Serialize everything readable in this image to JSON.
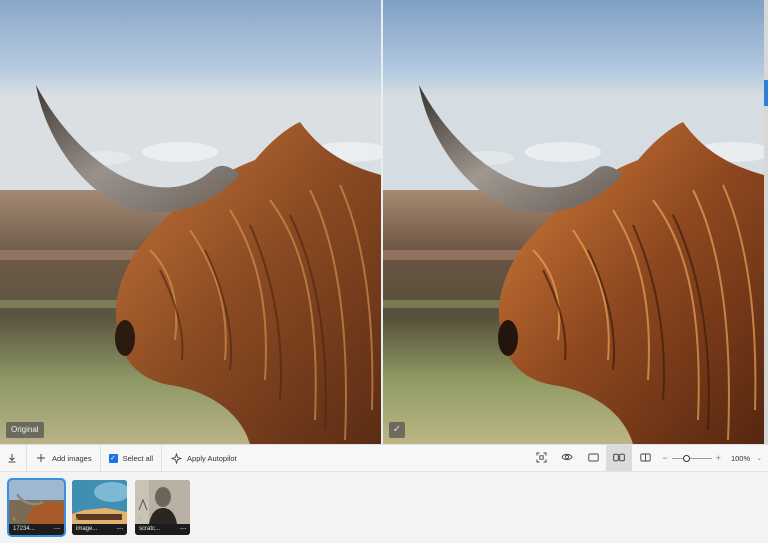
{
  "preview": {
    "original_label": "Original",
    "processed_badge": "✓"
  },
  "toolbar": {
    "export_icon": "download-icon",
    "add_images_icon": "plus-icon",
    "add_images_label": "Add images",
    "select_all_label": "Select all",
    "select_all_checked": true,
    "apply_autopilot_icon": "sparkle-icon",
    "apply_autopilot_label": "Apply Autopilot",
    "view_buttons": [
      "crop-focus-icon",
      "eye-icon",
      "single-view-icon",
      "side-by-side-icon",
      "split-view-icon"
    ],
    "active_view": "side-by-side-icon",
    "zoom_minus": "−",
    "zoom_plus": "+",
    "zoom_level": "100%",
    "zoom_slider_fraction": 0.35,
    "zoom_caret": "⌄"
  },
  "filmstrip": {
    "items": [
      {
        "name": "17234...",
        "more": "···",
        "selected": true
      },
      {
        "name": "image...",
        "more": "···",
        "selected": false
      },
      {
        "name": "scratc...",
        "more": "···",
        "selected": false
      }
    ]
  },
  "colors": {
    "accent": "#1a73e8",
    "selection": "#3a8ee6",
    "scrollbar_thumb": "#2f7ed8"
  }
}
